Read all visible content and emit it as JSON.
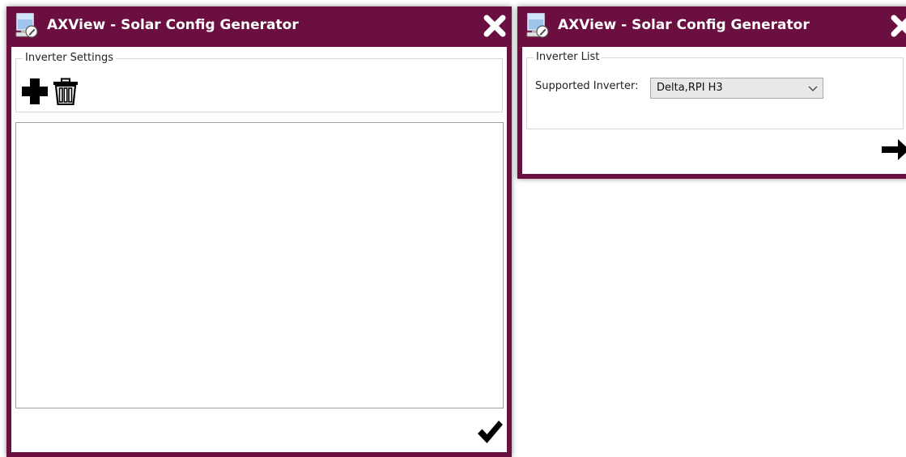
{
  "colors": {
    "titlebar": "#6b0f40",
    "title_text": "#ffffff",
    "icon": "#000000"
  },
  "left_window": {
    "title": "AXView - Solar Config Generator",
    "group_label": "Inverter Settings",
    "icons": {
      "app": "app-monitor-icon",
      "close": "close-icon",
      "add": "plus-icon",
      "delete": "trash-icon",
      "confirm": "checkmark-icon"
    }
  },
  "right_window": {
    "title": "AXView - Solar Config Generator",
    "group_label": "Inverter List",
    "supported_inverter_label": "Supported Inverter:",
    "supported_inverter_value": "Delta,RPI H3",
    "icons": {
      "app": "app-monitor-icon",
      "close": "close-icon",
      "dropdown": "chevron-down-icon",
      "next": "arrow-right-icon"
    }
  }
}
